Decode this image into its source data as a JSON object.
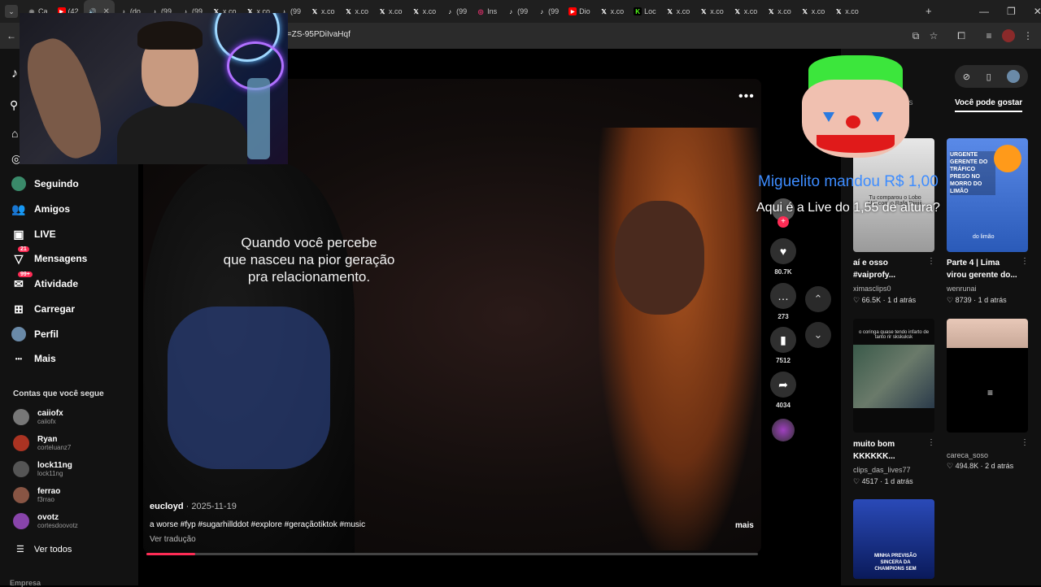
{
  "browser": {
    "tabs": [
      {
        "label": "Ca",
        "icon": "chrome-icon",
        "color": "#888888"
      },
      {
        "label": "(42",
        "icon": "youtube-icon",
        "color": "#ff0000"
      },
      {
        "label": "",
        "icon": "audio-icon",
        "color": "#cccccc",
        "active": true
      },
      {
        "label": "(do",
        "icon": "tiktok-icon",
        "color": "#ffffff"
      },
      {
        "label": "(99",
        "icon": "tiktok-icon",
        "color": "#ffffff"
      },
      {
        "label": "(99",
        "icon": "tiktok-icon",
        "color": "#ffffff"
      },
      {
        "label": "x.co",
        "icon": "x-icon",
        "color": "#ffffff"
      },
      {
        "label": "x.co",
        "icon": "x-icon",
        "color": "#ffffff"
      },
      {
        "label": "(99",
        "icon": "tiktok-icon",
        "color": "#ffffff"
      },
      {
        "label": "x.co",
        "icon": "x-icon",
        "color": "#ffffff"
      },
      {
        "label": "x.co",
        "icon": "x-icon",
        "color": "#ffffff"
      },
      {
        "label": "x.co",
        "icon": "x-icon",
        "color": "#ffffff"
      },
      {
        "label": "x.co",
        "icon": "x-icon",
        "color": "#ffffff"
      },
      {
        "label": "(99",
        "icon": "tiktok-icon",
        "color": "#ffffff"
      },
      {
        "label": "Ins",
        "icon": "instagram-icon",
        "color": "#e1306c"
      },
      {
        "label": "(99",
        "icon": "tiktok-icon",
        "color": "#ffffff"
      },
      {
        "label": "(99",
        "icon": "tiktok-icon",
        "color": "#ffffff"
      },
      {
        "label": "Dio",
        "icon": "youtube-icon",
        "color": "#ff0000"
      },
      {
        "label": "x.co",
        "icon": "x-icon",
        "color": "#ffffff"
      },
      {
        "label": "Loc",
        "icon": "kick-icon",
        "color": "#53fc18"
      },
      {
        "label": "x.co",
        "icon": "x-icon",
        "color": "#ffffff"
      },
      {
        "label": "x.co",
        "icon": "x-icon",
        "color": "#ffffff"
      },
      {
        "label": "x.co",
        "icon": "x-icon",
        "color": "#ffffff"
      },
      {
        "label": "x.co",
        "icon": "x-icon",
        "color": "#ffffff"
      },
      {
        "label": "x.co",
        "icon": "x-icon",
        "color": "#ffffff"
      },
      {
        "label": "x.co",
        "icon": "x-icon",
        "color": "#ffffff"
      }
    ],
    "url": "t=ZS-95PDiIvaHqf"
  },
  "sidebar": {
    "items": [
      {
        "label": "Seguindo",
        "icon": "avatar-icon"
      },
      {
        "label": "Amigos",
        "icon": "friends-icon"
      },
      {
        "label": "LIVE",
        "icon": "live-icon"
      },
      {
        "label": "Mensagens",
        "icon": "messages-icon",
        "badge": "21"
      },
      {
        "label": "Atividade",
        "icon": "activity-icon",
        "badge": "99+"
      },
      {
        "label": "Carregar",
        "icon": "upload-icon"
      },
      {
        "label": "Perfil",
        "icon": "profile-icon"
      },
      {
        "label": "Mais",
        "icon": "more-icon"
      }
    ],
    "following_title": "Contas que você segue",
    "accounts": [
      {
        "name": "caiiofx",
        "handle": "caiiofx",
        "color": "#777777"
      },
      {
        "name": "Ryan",
        "handle": "corteluanz7",
        "color": "#aa3322"
      },
      {
        "name": "lock11ng",
        "handle": "lock11ng",
        "color": "#555555"
      },
      {
        "name": "ferrao",
        "handle": "f3rrao",
        "color": "#885544"
      },
      {
        "name": "ovotz",
        "handle": "cortesdoovotz",
        "color": "#8844aa"
      }
    ],
    "see_all": "Ver todos",
    "company": "Empresa"
  },
  "video": {
    "caption_lines": [
      "Quando você percebe",
      "que nasceu na pior geração",
      "pra relacionamento."
    ],
    "author": "eucloyd",
    "date": "2025-11-19",
    "description": "a worse #fyp #sugarhillddot #explore #geraçãotiktok #music",
    "translate": "Ver tradução",
    "more": "mais",
    "progress": 0.08
  },
  "actions": {
    "likes": "80.7K",
    "comments": "273",
    "saves": "7512",
    "shares": "4034"
  },
  "right_panel": {
    "tab_prev": "ps",
    "tab_active": "Você pode gostar",
    "cards": [
      {
        "title": "aí e osso #vaiprofy...",
        "user": "ximasclips0",
        "likes": "66.5K",
        "ago": "1 d atrás",
        "color": "#d0d0d0"
      },
      {
        "title": "Parte 4 | Lima virou gerente do...",
        "user": "wenrunai",
        "likes": "8739",
        "ago": "1 d atrás",
        "color": "#3a7ad8"
      },
      {
        "title": "muito bom KKKKKK...",
        "user": "clips_das_lives77",
        "likes": "4517",
        "ago": "1 d atrás",
        "color": "#2a4a3a"
      },
      {
        "title": "",
        "user": "careca_soso",
        "likes": "494.8K",
        "ago": "2 d atrás",
        "color": "#d8b8a8"
      },
      {
        "title": "",
        "user": "",
        "likes": "",
        "ago": "",
        "color": "#1a3a8a"
      }
    ],
    "thumb_texts": {
      "c1": "Tu comparou o Lobo Uni com o Rafa Diiiiiii",
      "c2": "URGENTE GERENTE DO TRÁFICO PRESO NO MORRO DO LIMÃO",
      "c2b": "do limão",
      "c3": "o coringa quase tendo infarto de tanto rir skskuksk",
      "c5": "MINHA PREVISÃO SINCERA DA CHAMPIONS SEM"
    }
  },
  "overlay": {
    "donation_name": "Miguelito mandou R$ 1,00",
    "donation_message": "Aqui é a Live do 1,55 de altura?"
  },
  "colors": {
    "accent": "#fe2c55",
    "donation": "#3d8cff"
  }
}
